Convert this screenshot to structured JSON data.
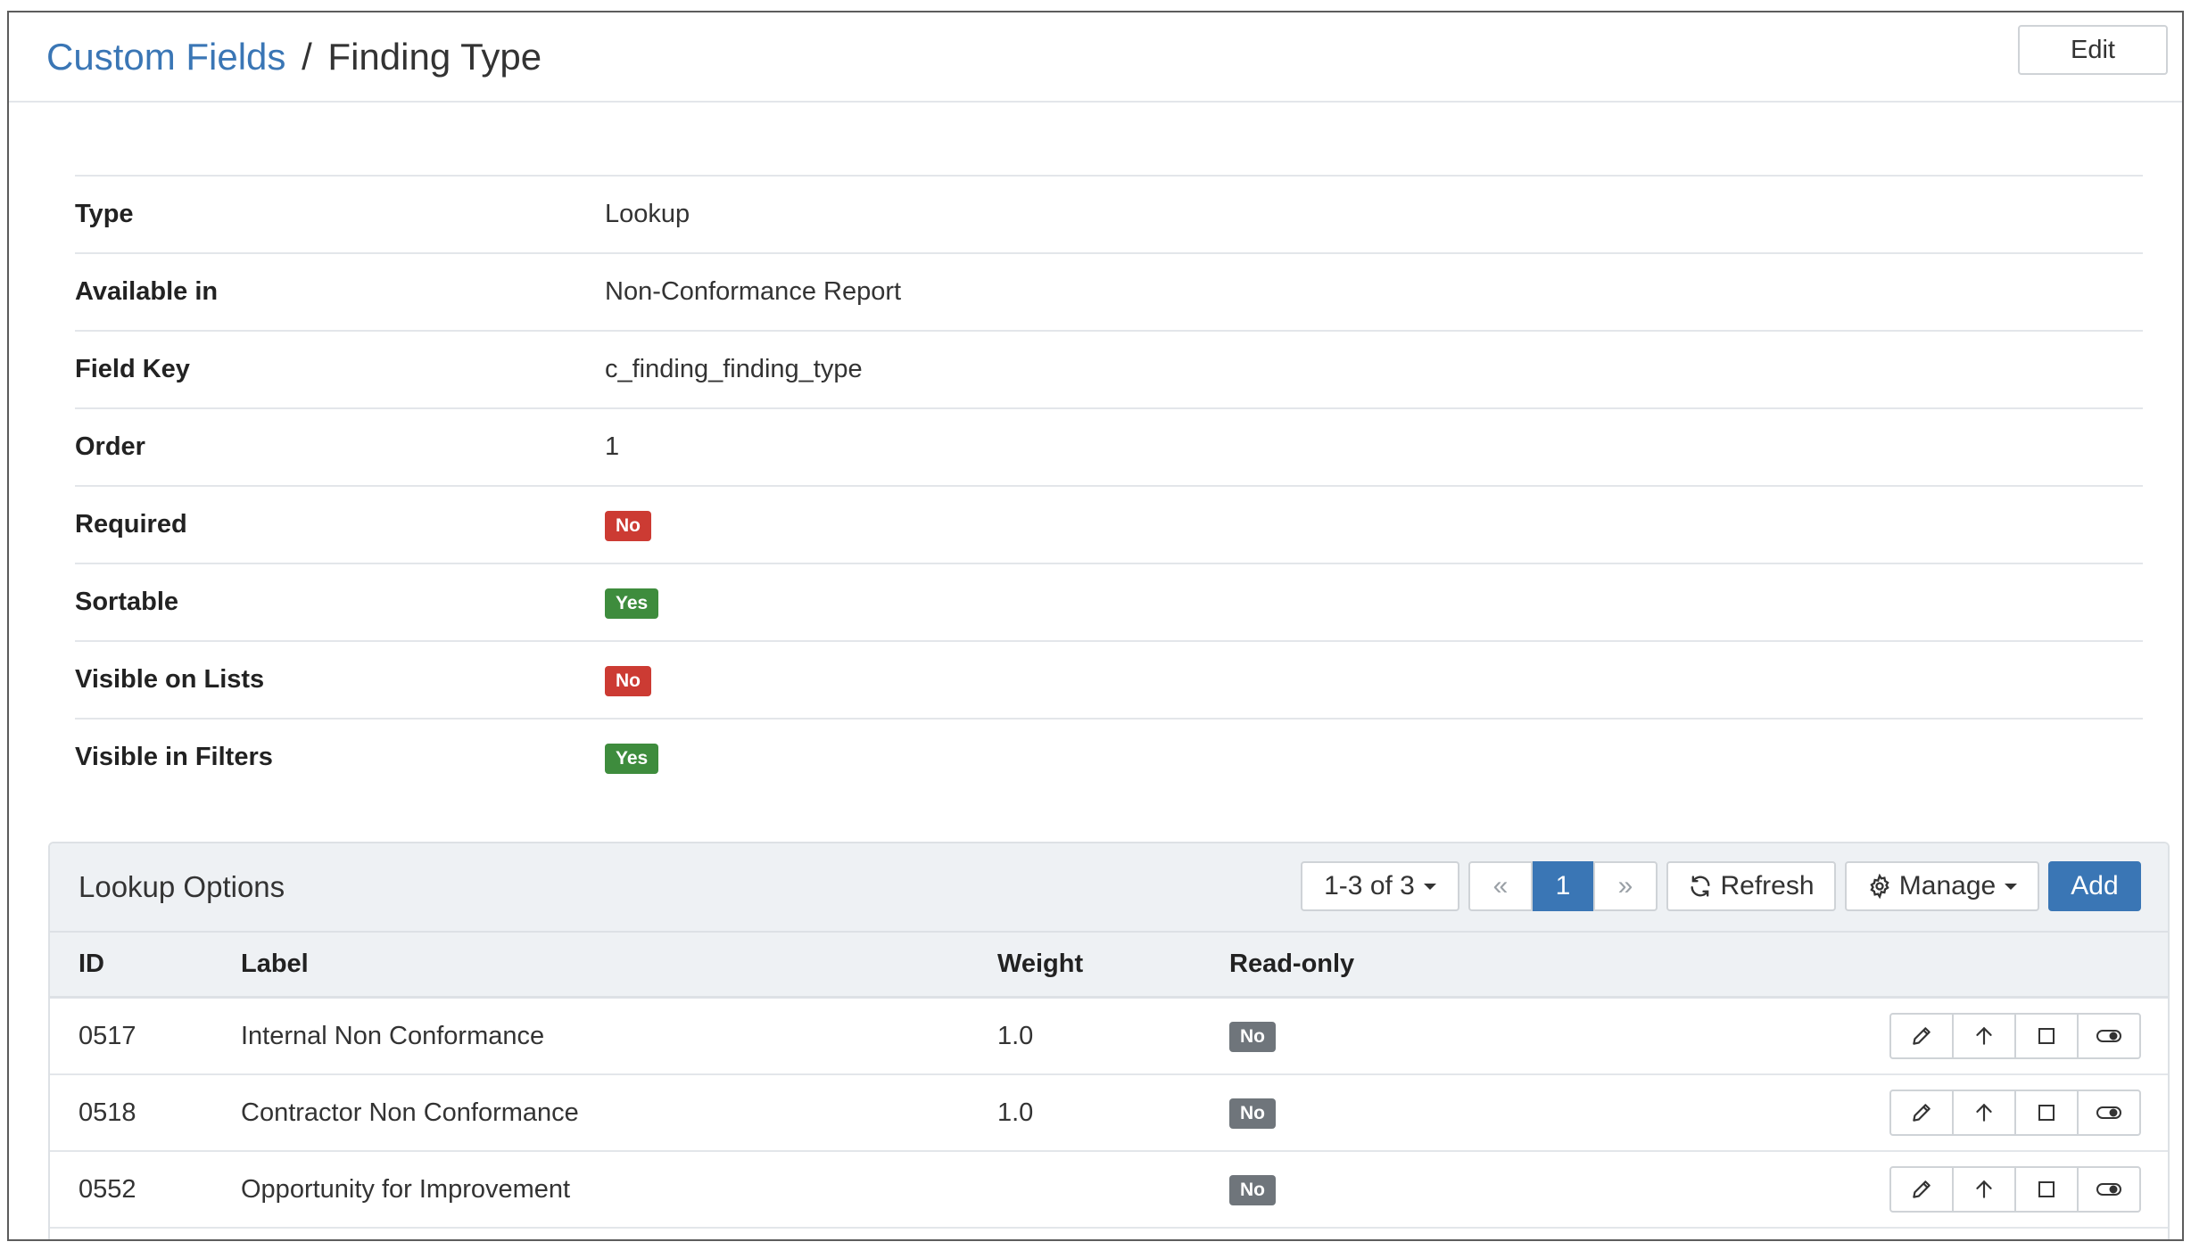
{
  "breadcrumb": {
    "parent": "Custom Fields",
    "separator": "/",
    "current": "Finding Type"
  },
  "header": {
    "edit_label": "Edit"
  },
  "details": [
    {
      "label": "Type",
      "value": "Lookup"
    },
    {
      "label": "Available in",
      "value": "Non-Conformance Report"
    },
    {
      "label": "Field Key",
      "value": "c_finding_finding_type"
    },
    {
      "label": "Order",
      "value": "1"
    },
    {
      "label": "Required",
      "badge": "No",
      "badge_color": "#cc3b33"
    },
    {
      "label": "Sortable",
      "badge": "Yes",
      "badge_color": "#3e8c3d"
    },
    {
      "label": "Visible on Lists",
      "badge": "No",
      "badge_color": "#cc3b33"
    },
    {
      "label": "Visible in Filters",
      "badge": "Yes",
      "badge_color": "#3e8c3d"
    }
  ],
  "panel": {
    "title": "Lookup Options",
    "range_label": "1-3 of 3",
    "first_glyph": "«",
    "current_page": "1",
    "next_glyph": "»",
    "refresh_label": "Refresh",
    "manage_label": "Manage",
    "add_label": "Add"
  },
  "table": {
    "columns": [
      "ID",
      "Label",
      "Weight",
      "Read-only"
    ],
    "rows": [
      {
        "id": "0517",
        "label": "Internal Non Conformance",
        "weight": "1.0",
        "readonly": "No"
      },
      {
        "id": "0518",
        "label": "Contractor Non Conformance",
        "weight": "1.0",
        "readonly": "No"
      },
      {
        "id": "0552",
        "label": "Opportunity for Improvement",
        "weight": "",
        "readonly": "No"
      }
    ]
  },
  "colors": {
    "link": "#3a76b5",
    "primary": "#3a76b5",
    "danger": "#cc3b33",
    "success": "#3e8c3d",
    "muted": "#6f757b"
  }
}
